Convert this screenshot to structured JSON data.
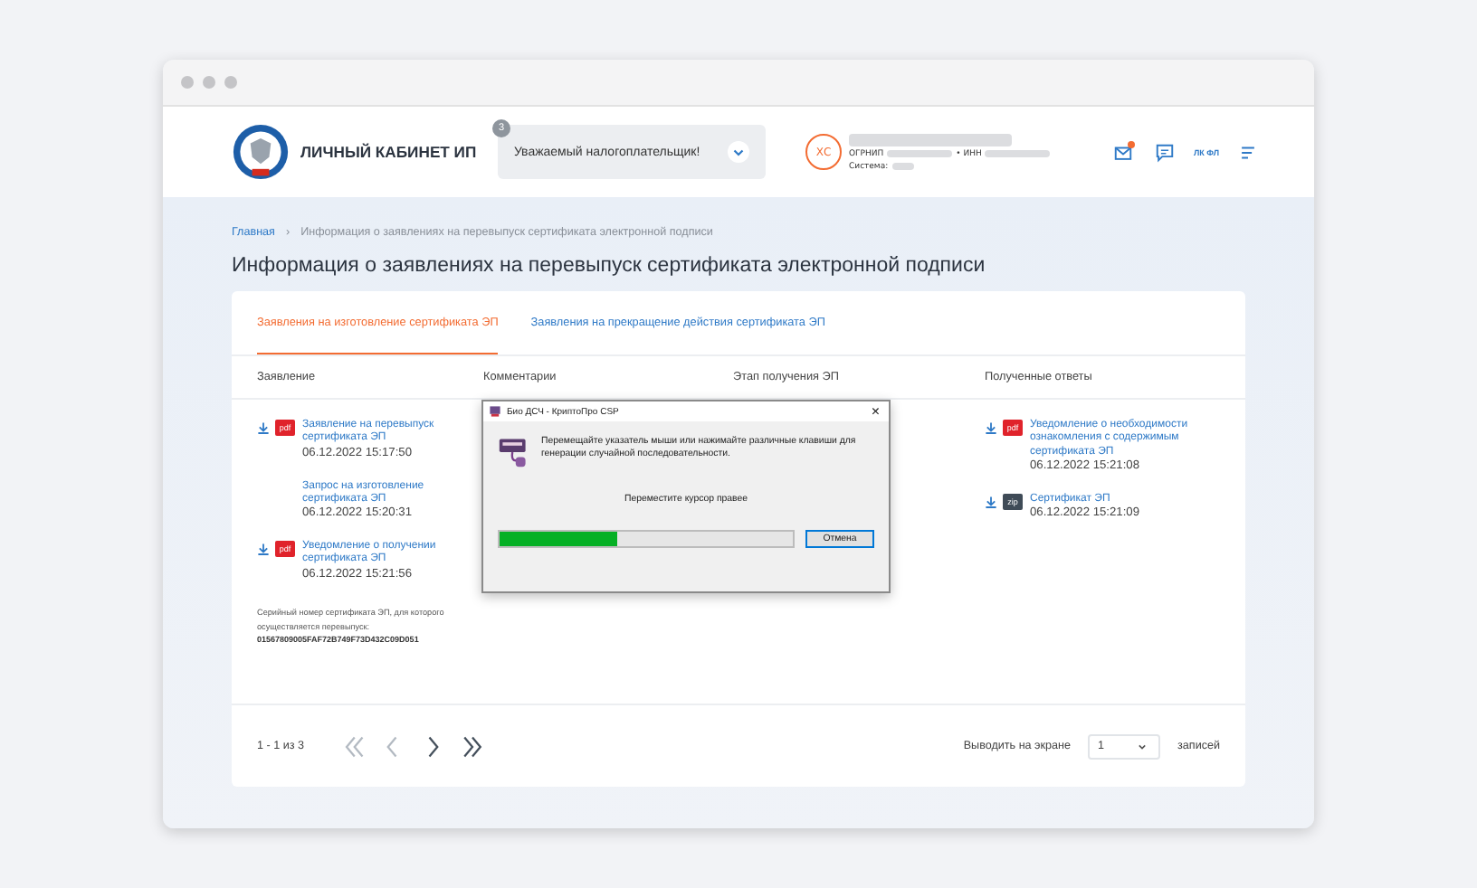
{
  "header": {
    "logo_text": "ЛИЧНЫЙ КАБИНЕТ ИП",
    "notice": {
      "count": "3",
      "text": "Уважаемый налогоплательщик!"
    },
    "user": {
      "initials": "ХС",
      "ogrnip_label": "ОГРНИП",
      "inn_label": "• ИНН",
      "system_label": "Система:"
    },
    "actions": [
      {
        "kind": "mail",
        "badge": true
      },
      {
        "kind": "chat",
        "badge": false
      },
      {
        "kind": "text",
        "label": "ЛК ФЛ",
        "badge": false
      },
      {
        "kind": "menu",
        "badge": false
      }
    ]
  },
  "breadcrumb_separator": "›",
  "breadcrumb": [
    {
      "label": "Главная",
      "link": true
    },
    {
      "label": "Информация о заявлениях на перевыпуск сертификата электронной подписи",
      "link": false
    }
  ],
  "title": "Информация о заявлениях на перевыпуск сертификата электронной подписи",
  "tabs": [
    {
      "label": "Заявления на изготовление сертификата ЭП",
      "selected": true
    },
    {
      "label": "Заявления на прекращение действия сертификата ЭП",
      "selected": false
    }
  ],
  "table": {
    "columns": [
      "Заявление",
      "Комментарии",
      "Этап получения ЭП",
      "Полученные ответы"
    ],
    "applications": [
      {
        "kind": "pdf",
        "badge": "pdf",
        "name": "Заявление на перевыпуск сертификата ЭП",
        "date": "06.12.2022 15:17:50"
      },
      {
        "kind": "none",
        "name": "Запрос на изготовление сертификата ЭП",
        "date": "06.12.2022 15:20:31"
      },
      {
        "kind": "pdf",
        "badge": "pdf",
        "name": "Уведомление о получении сертификата ЭП",
        "date": "06.12.2022 15:21:56"
      }
    ],
    "serial_note": "Серийный номер сертификата ЭП, для которого осуществляется перевыпуск:",
    "serial": "01567809005FAF72B749F73D432C09D051",
    "responses": [
      {
        "kind": "pdf",
        "badge": "pdf",
        "name": "Уведомление о необходимости ознакомления с содержимым сертификата ЭП",
        "date": "06.12.2022 15:21:08"
      },
      {
        "kind": "zip",
        "badge": "zip",
        "name": "Сертификат ЭП",
        "date": "06.12.2022 15:21:09"
      }
    ]
  },
  "pagination": {
    "range": "1 - 1 из 3",
    "buttons": [
      {
        "kind": "first",
        "disabled": true
      },
      {
        "kind": "prev",
        "disabled": true
      },
      {
        "kind": "next",
        "disabled": false
      },
      {
        "kind": "last",
        "disabled": false
      }
    ],
    "per_page_label": "Выводить на экране",
    "per_page": "1",
    "records_label": "записей"
  },
  "dialog": {
    "title": "Био ДСЧ - КриптоПро CSP",
    "close": "×",
    "message": "Перемещайте указатель мыши или нажимайте различные клавиши для генерации случайной последовательности.",
    "hint": "Переместите курсор правее",
    "level": 0.4,
    "cancel": "Отмена"
  }
}
